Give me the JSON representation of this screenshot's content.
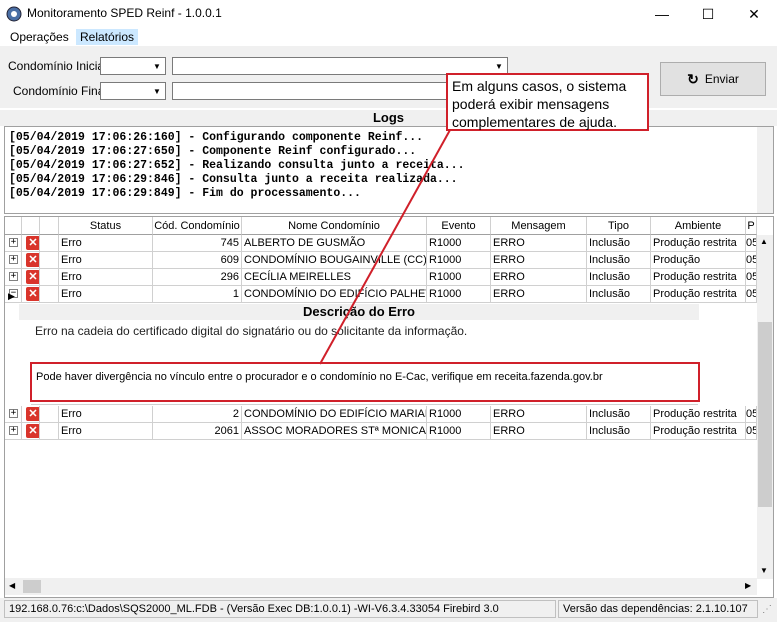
{
  "window": {
    "title": "Monitoramento SPED Reinf - 1.0.0.1",
    "minimize": "—",
    "maximize": "☐",
    "close": "✕"
  },
  "menu": {
    "items": [
      {
        "label": "Operações"
      },
      {
        "label": "Relatórios"
      }
    ]
  },
  "filters": {
    "inicial_label": "Condomínio Inicial",
    "final_label": "Condomínio Final",
    "inicial_code": "",
    "inicial_name": "",
    "final_code": "",
    "final_name": ""
  },
  "actions": {
    "enviar_label": "Enviar"
  },
  "logs": {
    "header": "Logs",
    "lines": [
      "[05/04/2019 17:06:26:160] - Configurando componente Reinf...",
      "[05/04/2019 17:06:27:650] - Componente Reinf configurado...",
      "[05/04/2019 17:06:27:652] - Realizando consulta junto a receita...",
      "[05/04/2019 17:06:29:846] - Consulta junto a receita realizada...",
      "[05/04/2019 17:06:29:849] - Fim do processamento..."
    ]
  },
  "grid": {
    "columns": [
      "",
      "",
      "Status",
      "Cód. Condomínio",
      "Nome Condomínio",
      "Evento",
      "Mensagem",
      "Tipo",
      "Ambiente",
      "P"
    ],
    "rows_top": [
      {
        "status": "Erro",
        "codigo": "745",
        "nome": "ALBERTO DE GUSMÃO",
        "evento": "R1000",
        "mensagem": "ERRO",
        "tipo": "Inclusão",
        "ambiente": "Produção restrita",
        "p": "05"
      },
      {
        "status": "Erro",
        "codigo": "609",
        "nome": "CONDOMÍNIO BOUGAINVILLE (CC)",
        "evento": "R1000",
        "mensagem": "ERRO",
        "tipo": "Inclusão",
        "ambiente": "Produção",
        "p": "05"
      },
      {
        "status": "Erro",
        "codigo": "296",
        "nome": "CECÍLIA MEIRELLES",
        "evento": "R1000",
        "mensagem": "ERRO",
        "tipo": "Inclusão",
        "ambiente": "Produção restrita",
        "p": "05"
      },
      {
        "status": "Erro",
        "codigo": "1",
        "nome": "CONDOMÍNIO DO EDIFÍCIO PALHET",
        "evento": "R1000",
        "mensagem": "ERRO",
        "tipo": "Inclusão",
        "ambiente": "Produção restrita",
        "p": "05"
      }
    ],
    "rows_bottom": [
      {
        "status": "Erro",
        "codigo": "2",
        "nome": "CONDOMÍNIO DO EDIFÍCIO MARIAN",
        "evento": "R1000",
        "mensagem": "ERRO",
        "tipo": "Inclusão",
        "ambiente": "Produção restrita",
        "p": "05"
      },
      {
        "status": "Erro",
        "codigo": "2061",
        "nome": "ASSOC MORADORES STª MONICA -",
        "evento": "R1000",
        "mensagem": "ERRO",
        "tipo": "Inclusão",
        "ambiente": "Produção restrita",
        "p": "05"
      }
    ],
    "detail": {
      "title": "Descrição do Erro",
      "error_text": "Erro na cadeia do certificado digital do signatário ou do solicitante da informação.",
      "suggestion_text": "Pode haver divergência no vínculo entre o procurador e o condomínio no E-Cac, verifique em receita.fazenda.gov.br"
    }
  },
  "callout": {
    "text": "Em alguns casos, o sistema poderá exibir mensagens complementares de ajuda.",
    "color": "#d0202a"
  },
  "statusbar": {
    "connection": "192.168.0.76:c:\\Dados\\SQS2000_ML.FDB - (Versão Exec DB:1.0.0.1) -WI-V6.3.4.33054 Firebird 3.0",
    "dependencies": "Versão das dependências: 2.1.10.107"
  }
}
